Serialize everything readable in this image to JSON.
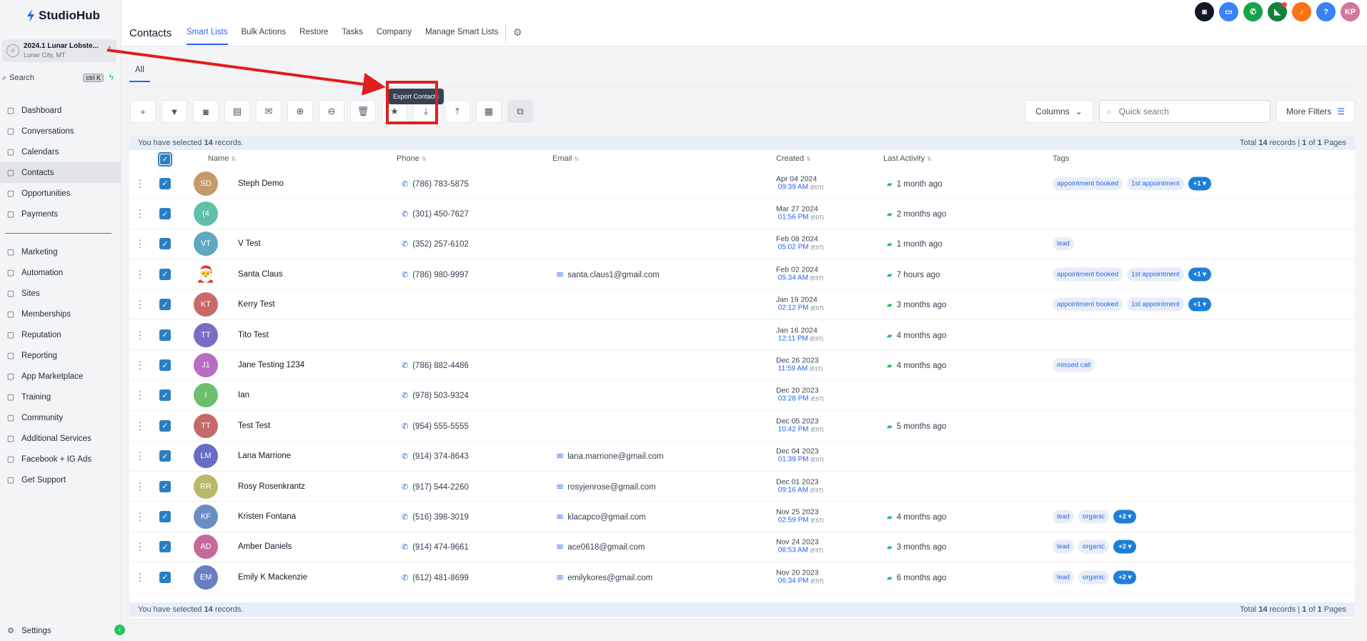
{
  "app": {
    "brand": "StudioHub"
  },
  "account": {
    "name": "2024.1 Lunar Lobste...",
    "location": "Lunar City, MT"
  },
  "search": {
    "label": "Search",
    "shortcut": "ctrl K"
  },
  "nav": {
    "primary": [
      {
        "label": "Dashboard",
        "icon": "dashboard-icon"
      },
      {
        "label": "Conversations",
        "icon": "chat-icon"
      },
      {
        "label": "Calendars",
        "icon": "calendar-icon"
      },
      {
        "label": "Contacts",
        "icon": "contacts-icon",
        "active": true
      },
      {
        "label": "Opportunities",
        "icon": "opportunities-icon"
      },
      {
        "label": "Payments",
        "icon": "payments-icon"
      }
    ],
    "secondary": [
      {
        "label": "Marketing",
        "icon": "send-icon"
      },
      {
        "label": "Automation",
        "icon": "automation-icon"
      },
      {
        "label": "Sites",
        "icon": "sites-icon"
      },
      {
        "label": "Memberships",
        "icon": "membership-icon"
      },
      {
        "label": "Reputation",
        "icon": "star-icon"
      },
      {
        "label": "Reporting",
        "icon": "chart-icon"
      },
      {
        "label": "App Marketplace",
        "icon": "apps-icon"
      },
      {
        "label": "Training",
        "icon": "book-icon"
      },
      {
        "label": "Community",
        "icon": "community-icon"
      },
      {
        "label": "Additional Services",
        "icon": "cart-icon"
      },
      {
        "label": "Facebook + IG Ads",
        "icon": "facebook-icon"
      },
      {
        "label": "Get Support",
        "icon": "support-icon"
      }
    ],
    "settings": "Settings"
  },
  "header": {
    "title": "Contacts",
    "tabs": [
      "Smart Lists",
      "Bulk Actions",
      "Restore",
      "Tasks",
      "Company",
      "Manage Smart Lists"
    ],
    "active_tab": "Smart Lists",
    "user_initials": "KP"
  },
  "subtabs": [
    "All"
  ],
  "toolbar": {
    "tooltip": "Export Contacts",
    "columns_label": "Columns",
    "search_placeholder": "Quick search",
    "more_filters_label": "More Filters"
  },
  "selection": {
    "prefix": "You have selected",
    "count": "14",
    "suffix": "records.",
    "total_prefix": "Total",
    "total_count": "14",
    "total_middle": "records |",
    "page": "1",
    "page_middle": "of",
    "pages": "1",
    "page_suffix": "Pages"
  },
  "columns": [
    "Name",
    "Phone",
    "Email",
    "Created",
    "Last Activity",
    "Tags"
  ],
  "contacts": [
    {
      "initials": "SD",
      "color": "#c49a6c",
      "name": "Steph Demo",
      "phone": "(786) 783-5875",
      "email": "",
      "created_date": "Apr 04 2024",
      "created_time": "09:39 AM",
      "tz": "(EDT)",
      "activity": "1 month ago",
      "tags": [
        "appointment booked",
        "1st appointment"
      ],
      "more": "+1"
    },
    {
      "initials": "(4",
      "color": "#5fbfa8",
      "name": "",
      "phone": "(301) 450-7627",
      "email": "",
      "created_date": "Mar 27 2024",
      "created_time": "01:56 PM",
      "tz": "(EDT)",
      "activity": "2 months ago",
      "tags": [],
      "more": ""
    },
    {
      "initials": "VT",
      "color": "#5fa8c0",
      "name": "V Test",
      "phone": "(352) 257-6102",
      "email": "",
      "created_date": "Feb 08 2024",
      "created_time": "05:02 PM",
      "tz": "(EST)",
      "activity": "1 month ago",
      "tags": [
        "lead"
      ],
      "more": ""
    },
    {
      "initials": "",
      "color": "#ffffff",
      "santa": true,
      "name": "Santa Claus",
      "phone": "(786) 980-9997",
      "email": "santa.claus1@gmail.com",
      "created_date": "Feb 02 2024",
      "created_time": "05:34 AM",
      "tz": "(EST)",
      "activity": "7 hours ago",
      "tags": [
        "appointment booked",
        "1st appointment"
      ],
      "more": "+1"
    },
    {
      "initials": "KT",
      "color": "#c86a6a",
      "name": "Kerry Test",
      "phone": "",
      "email": "",
      "created_date": "Jan 19 2024",
      "created_time": "02:12 PM",
      "tz": "(EST)",
      "activity": "3 months ago",
      "tags": [
        "appointment booked",
        "1st appointment"
      ],
      "more": "+1"
    },
    {
      "initials": "TT",
      "color": "#7a6cc4",
      "name": "Tito Test",
      "phone": "",
      "email": "",
      "created_date": "Jan 16 2024",
      "created_time": "12:11 PM",
      "tz": "(EST)",
      "activity": "4 months ago",
      "tags": [],
      "more": ""
    },
    {
      "initials": "J1",
      "color": "#b86cc4",
      "name": "Jane Testing 1234",
      "phone": "(786) 882-4486",
      "email": "",
      "created_date": "Dec 26 2023",
      "created_time": "11:59 AM",
      "tz": "(EST)",
      "activity": "4 months ago",
      "tags": [
        "missed call"
      ],
      "more": ""
    },
    {
      "initials": "I",
      "color": "#6cbf6c",
      "name": "Ian",
      "phone": "(978) 503-9324",
      "email": "",
      "created_date": "Dec 20 2023",
      "created_time": "03:28 PM",
      "tz": "(EST)",
      "activity": "",
      "tags": [],
      "more": ""
    },
    {
      "initials": "TT",
      "color": "#c46a6a",
      "name": "Test Test",
      "phone": "(954) 555-5555",
      "email": "",
      "created_date": "Dec 05 2023",
      "created_time": "10:42 PM",
      "tz": "(EST)",
      "activity": "5 months ago",
      "tags": [],
      "more": ""
    },
    {
      "initials": "LM",
      "color": "#6a6cc4",
      "name": "Lana Marrione",
      "phone": "(914) 374-8643",
      "email": "lana.marrione@gmail.com",
      "created_date": "Dec 04 2023",
      "created_time": "01:39 PM",
      "tz": "(EST)",
      "activity": "",
      "tags": [],
      "more": ""
    },
    {
      "initials": "RR",
      "color": "#b8b86a",
      "name": "Rosy Rosenkrantz",
      "phone": "(917) 544-2260",
      "email": "rosyjenrose@gmail.com",
      "created_date": "Dec 01 2023",
      "created_time": "09:16 AM",
      "tz": "(EST)",
      "activity": "",
      "tags": [],
      "more": ""
    },
    {
      "initials": "KF",
      "color": "#6a8ec4",
      "name": "Kristen Fontana",
      "phone": "(516) 398-3019",
      "email": "klacapco@gmail.com",
      "created_date": "Nov 25 2023",
      "created_time": "02:59 PM",
      "tz": "(EST)",
      "activity": "4 months ago",
      "tags": [
        "lead",
        "organic"
      ],
      "more": "+2"
    },
    {
      "initials": "AD",
      "color": "#c46a9a",
      "name": "Amber Daniels",
      "phone": "(914) 474-9661",
      "email": "ace0618@gmail.com",
      "created_date": "Nov 24 2023",
      "created_time": "08:53 AM",
      "tz": "(EST)",
      "activity": "3 months ago",
      "tags": [
        "lead",
        "organic"
      ],
      "more": "+2"
    },
    {
      "initials": "EM",
      "color": "#6a7ec4",
      "name": "Emily K Mackenzie",
      "phone": "(612) 481-8699",
      "email": "emilykores@gmail.com",
      "created_date": "Nov 20 2023",
      "created_time": "06:34 PM",
      "tz": "(EST)",
      "activity": "6 months ago",
      "tags": [
        "lead",
        "organic"
      ],
      "more": "+2"
    }
  ],
  "colors": {
    "accent": "#2563eb",
    "checkbox": "#2b7fc1",
    "annotation": "#e11d1d"
  }
}
